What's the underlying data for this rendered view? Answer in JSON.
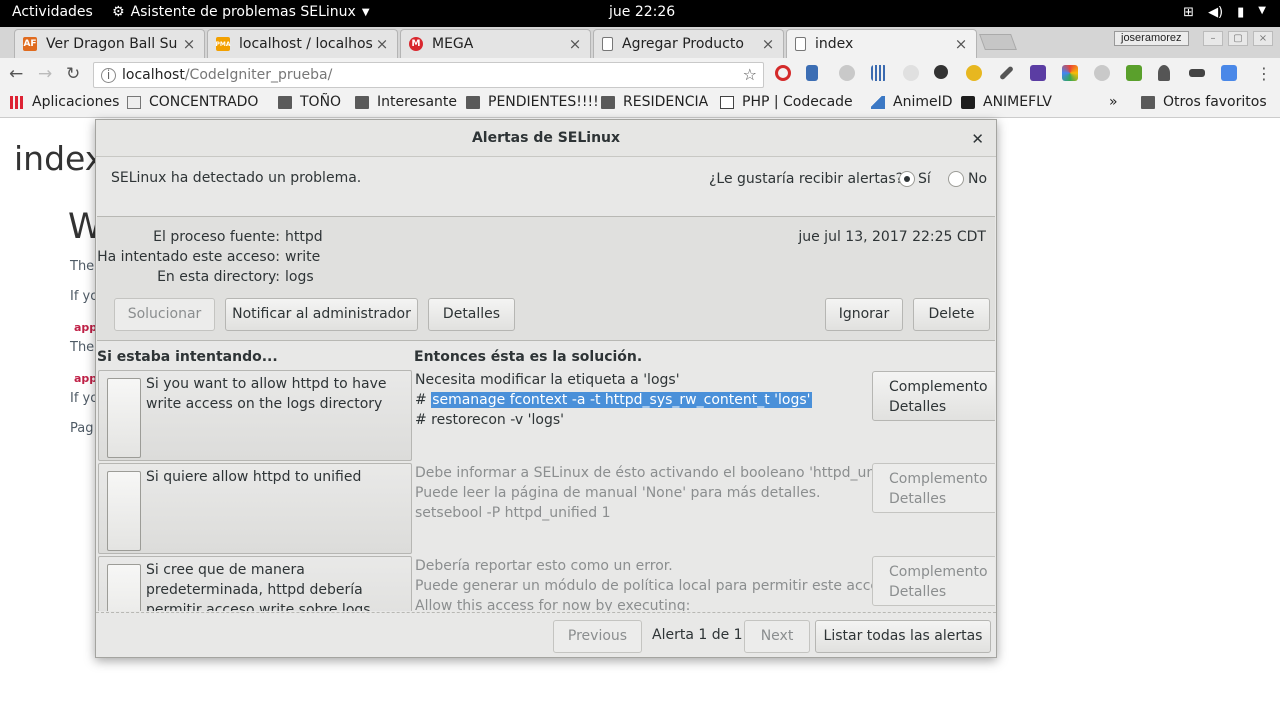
{
  "topbar": {
    "activities": "Actividades",
    "app_name": "Asistente de problemas SELinux",
    "clock": "jue 22:26"
  },
  "tabs": [
    {
      "title": "Ver Dragon Ball Su",
      "fav_text": "AF",
      "fav_color": "#e06b1f"
    },
    {
      "title": "localhost / localhos",
      "fav_text": "PMA",
      "fav_color": "#f2a000"
    },
    {
      "title": "MEGA",
      "fav_text": "M",
      "fav_color": "#d9272e"
    },
    {
      "title": "Agregar Producto",
      "fav_text": "",
      "fav_color": "#ffffff"
    },
    {
      "title": "index",
      "fav_text": "",
      "fav_color": "#ffffff"
    }
  ],
  "profile": "joseramorez",
  "address": {
    "host": "localhost",
    "path": "/CodeIgniter_prueba/"
  },
  "bookmarks": [
    "Aplicaciones",
    "CONCENTRADO",
    "TOÑO",
    "Interesante",
    "PENDIENTES!!!!",
    "RESIDENCIA",
    "PHP | Codecade",
    "AnimeID",
    "ANIMEFLV",
    "»",
    "Otros favoritos"
  ],
  "page": {
    "h1": "index",
    "h2": "W",
    "lines": [
      "The",
      "If yo",
      "app",
      "The",
      "app",
      "If yo",
      "Pag"
    ]
  },
  "dialog": {
    "title": "Alertas de SELinux",
    "detected": "SELinux ha detectado un problema.",
    "question": "¿Le gustaría recibir alertas?",
    "yes": "Sí",
    "no": "No",
    "labels": [
      "El proceso fuente:",
      "Ha intentado este acceso:",
      "En esta directory:"
    ],
    "values": [
      "httpd",
      "write",
      "logs"
    ],
    "date": "jue jul 13, 2017 22:25 CDT",
    "buttons": {
      "solve": "Solucionar",
      "notify": "Notificar al administrador",
      "details": "Detalles",
      "ignore": "Ignorar",
      "delete": "Delete"
    },
    "col_left": "Si estaba intentando...",
    "col_right": "Entonces ésta es la solución.",
    "plugins": [
      {
        "option": "Si you want to allow httpd to have write access on the logs directory",
        "lines": [
          "Necesita modificar la etiqueta a 'logs'",
          "# ",
          "semanage fcontext -a -t httpd_sys_rw_content_t 'logs'",
          "# restorecon -v 'logs'"
        ]
      },
      {
        "option": "Si quiere allow httpd to unified",
        "lines": [
          "Debe informar a SELinux de ésto activando el booleano 'httpd_unified'.",
          "Puede leer la página de manual 'None' para más detalles.",
          "setsebool -P httpd_unified 1"
        ]
      },
      {
        "option": "Si cree que de manera predeterminada, httpd debería permitir acceso write sobre logs directory.",
        "lines": [
          "Debería reportar esto como un error.",
          "Puede generar un módulo de política local para permitir este acceso.",
          "Allow this access for now by executing:"
        ]
      }
    ],
    "plugin_btn": [
      "Complemento",
      "Detalles"
    ],
    "footer": {
      "previous": "Previous",
      "counter": "Alerta 1 de 1",
      "next": "Next",
      "list_all": "Listar todas las alertas"
    }
  }
}
